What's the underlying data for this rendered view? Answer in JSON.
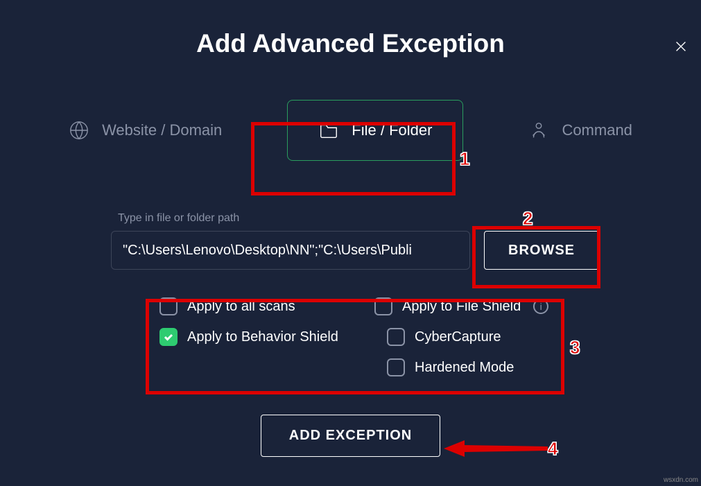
{
  "title": "Add Advanced Exception",
  "tabs": {
    "website": "Website / Domain",
    "file_folder": "File / Folder",
    "command": "Command"
  },
  "path": {
    "label": "Type in file or folder path",
    "value": "\"C:\\Users\\Lenovo\\Desktop\\NN\";\"C:\\Users\\Publi",
    "browse": "BROWSE"
  },
  "options": {
    "all_scans": "Apply to all scans",
    "file_shield": "Apply to File Shield",
    "behavior_shield": "Apply to Behavior Shield",
    "cybercapture": "CyberCapture",
    "hardened_mode": "Hardened Mode"
  },
  "add_button": "ADD EXCEPTION",
  "annotations": {
    "n1": "1",
    "n2": "2",
    "n3": "3",
    "n4": "4"
  },
  "watermark": "wsxdn.com"
}
